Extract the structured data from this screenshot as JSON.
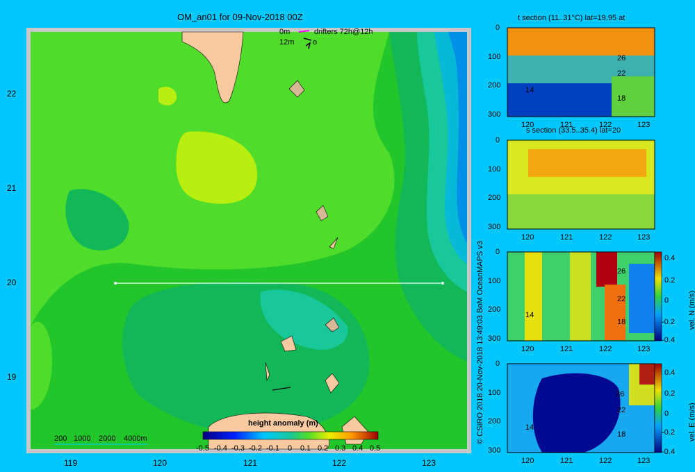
{
  "map": {
    "title": "OM_an01 for 09-Nov-2018 00Z",
    "legend_0m": "0m",
    "legend_12m": "12m",
    "drifters": "drifters 72h@12h",
    "drifters_suffix": "o",
    "depth_legend": [
      "200",
      "1000",
      "2000",
      "4000m"
    ],
    "x_ticks": [
      "119",
      "120",
      "121",
      "122",
      "123"
    ],
    "y_ticks": [
      "22",
      "21",
      "20",
      "19"
    ],
    "section_lat": 20,
    "colors": {
      "land": "#f9c9a0",
      "frame": "#c9c9c9",
      "section_line": "#ffffff"
    }
  },
  "colorbar": {
    "label": "height anomaly (m)",
    "ticks": [
      "-0.5",
      "-0.4",
      "-0.3",
      "-0.2",
      "-0.1",
      "0",
      "0.1",
      "0.2",
      "0.3",
      "0.4",
      "0.5"
    ]
  },
  "credit": "© CSIRO 2018   20-Nov-2018 13:49:03 BoM OceanMAPS v3",
  "panels": [
    {
      "title": "t section (11..31°C) lat=19.95 at",
      "y_ticks": [
        "0",
        "100",
        "200",
        "300"
      ],
      "x_ticks": [
        "120",
        "121",
        "122",
        "123"
      ],
      "contour_labels": [
        "26",
        "22",
        "14",
        "18"
      ]
    },
    {
      "title": "s section (33.5..35.4) lat=20",
      "y_ticks": [
        "0",
        "100",
        "200",
        "300"
      ],
      "x_ticks": [
        "120",
        "121",
        "122",
        "123"
      ]
    },
    {
      "y_ticks": [
        "0",
        "100",
        "200",
        "300"
      ],
      "x_ticks": [
        "120",
        "121",
        "122",
        "123"
      ],
      "contour_labels": [
        "26",
        "22",
        "14",
        "18"
      ],
      "cbar_ticks": [
        "0.4",
        "0.2",
        "0",
        "-0.2",
        "-0.4"
      ],
      "cbar_label": "vel. N (m/s)"
    },
    {
      "y_ticks": [
        "0",
        "100",
        "200",
        "300"
      ],
      "x_ticks": [
        "120",
        "121",
        "122",
        "123"
      ],
      "contour_labels": [
        "26",
        "22",
        "14",
        "18"
      ],
      "cbar_ticks": [
        "0.4",
        "0.2",
        "0",
        "-0.2",
        "-0.4"
      ],
      "cbar_label": "vel. E (m/s)"
    }
  ],
  "chart_data": {
    "type": "heatmap",
    "title": "OM_an01 for 09-Nov-2018 00Z",
    "variable": "height anomaly (m)",
    "x_axis": "longitude",
    "y_axis": "latitude",
    "xlim": [
      118.5,
      123.5
    ],
    "ylim": [
      18.25,
      22.7
    ],
    "value_range": [
      -0.5,
      0.5
    ],
    "section_line": {
      "lat": 20,
      "lon_start": 119.5,
      "lon_end": 123.2
    }
  }
}
